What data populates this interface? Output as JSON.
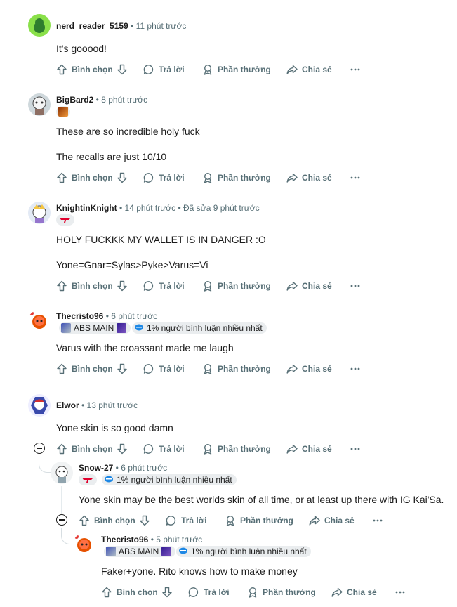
{
  "actions": {
    "vote": "Bình chọn",
    "reply": "Trả lời",
    "award": "Phần thưởng",
    "share": "Chia sẻ"
  },
  "comments": [
    {
      "user": "nerd_reader_5159",
      "time": "11 phút trước",
      "lines": [
        "It's gooood!"
      ]
    },
    {
      "user": "BigBard2",
      "time": "8 phút trước",
      "lines": [
        "These are so incredible holy fuck",
        "The recalls are just 10/10"
      ]
    },
    {
      "user": "KnightinKnight",
      "time": "14 phút trước",
      "edited": "Đã sửa 9 phút trước",
      "lines": [
        "HOLY FUCKKK MY WALLET IS IN DANGER :O",
        "Yone=Gnar=Sylas>Pyke>Varus=Vi"
      ]
    },
    {
      "user": "Thecristo96",
      "time": "6 phút trước",
      "flair": "ABS MAIN",
      "badge": "1% người bình luận nhiều nhất",
      "lines": [
        "Varus with the croassant made me laugh"
      ]
    },
    {
      "user": "Elwor",
      "time": "13 phút trước",
      "lines": [
        "Yone skin is so good damn"
      ]
    },
    {
      "user": "Snow-27",
      "time": "6 phút trước",
      "badge": "1% người bình luận nhiều nhất",
      "lines": [
        "Yone skin may be the best worlds skin of all time, or at least up there with IG Kai'Sa."
      ]
    },
    {
      "user": "Thecristo96",
      "time": "5 phút trước",
      "flair": "ABS MAIN",
      "badge": "1% người bình luận nhiều nhất",
      "lines": [
        "Faker+yone. Rito knows how to make money"
      ]
    }
  ],
  "colors": {
    "meta": "#576f76",
    "text": "#1c1c1c",
    "flair_bg": "#eaedef",
    "thread": "#e5ebee"
  },
  "icons": [
    "arrow-up-icon",
    "arrow-down-icon",
    "chat-bubble-icon",
    "award-icon",
    "share-icon",
    "more-icon",
    "minus-circle-icon"
  ]
}
